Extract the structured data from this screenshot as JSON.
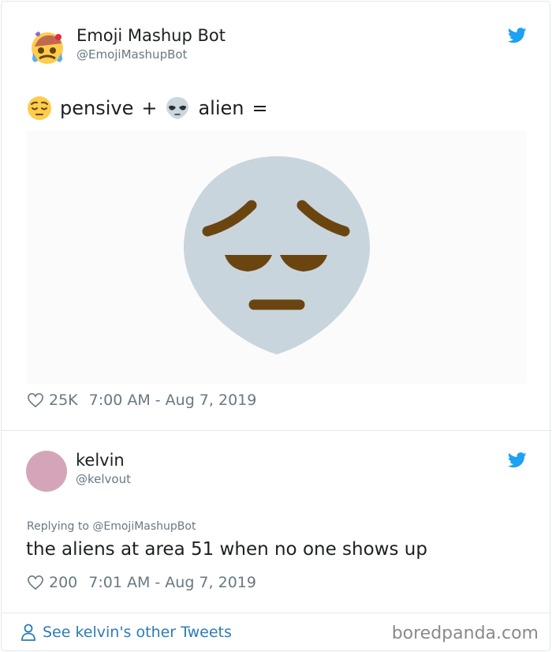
{
  "tweet1": {
    "author_name": "Emoji Mashup Bot",
    "author_handle": "@EmojiMashupBot",
    "text_a": "pensive",
    "text_plus": "+",
    "text_b": "alien",
    "text_eq": "=",
    "like_count": "25K",
    "timestamp": "7:00 AM - Aug 7, 2019"
  },
  "tweet2": {
    "author_name": "kelvin",
    "author_handle": "@kelvout",
    "avatar_color": "#d4a5b8",
    "reply_context": "Replying to @EmojiMashupBot",
    "text": "the aliens at area 51 when no one shows up",
    "like_count": "200",
    "timestamp": "7:01 AM - Aug 7, 2019"
  },
  "footer": {
    "see_more": "See kelvin's other Tweets",
    "watermark": "boredpanda.com"
  },
  "colors": {
    "twitter_blue": "#1da1f2",
    "link_blue": "#2b7bb9",
    "alien_gray": "#c9d5dc",
    "feature_brown": "#6b4510",
    "pensive_yellow": "#ffcc4d"
  },
  "icons": [
    "twitter-bird-icon",
    "heart-icon",
    "person-icon",
    "pensive-emoji-icon",
    "alien-emoji-icon"
  ]
}
